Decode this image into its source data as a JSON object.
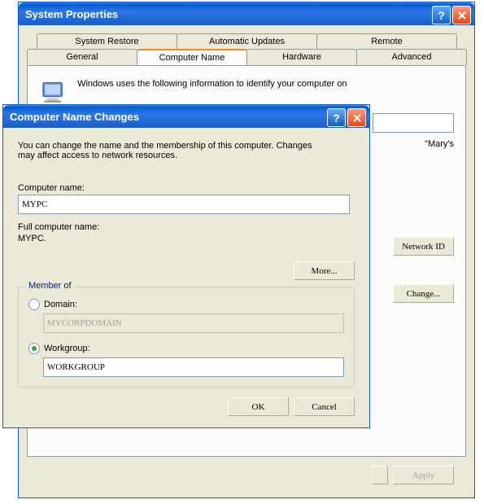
{
  "parent": {
    "title": "System Properties",
    "tabs_row1": [
      "System Restore",
      "Automatic Updates",
      "Remote"
    ],
    "tabs_row2": [
      "General",
      "Computer Name",
      "Hardware",
      "Advanced"
    ],
    "icon_desc": "Windows uses the following information to identify your computer on",
    "example": "\"Mary's",
    "btn_network_id": "Network ID",
    "btn_change": "Change...",
    "btn_apply": "Apply"
  },
  "dlg": {
    "title": "Computer Name Changes",
    "intro": "You can change the name and the membership of this computer. Changes may affect access to network resources.",
    "lbl_computer_name": "Computer name:",
    "computer_name": "MYPC",
    "lbl_full": "Full computer name:",
    "full_name": "MYPC.",
    "btn_more": "More...",
    "legend": "Member of",
    "lbl_domain": "Domain:",
    "domain_placeholder": "MYCORPDOMAIN",
    "lbl_workgroup": "Workgroup:",
    "workgroup": "WORKGROUP",
    "btn_ok": "OK",
    "btn_cancel": "Cancel"
  }
}
